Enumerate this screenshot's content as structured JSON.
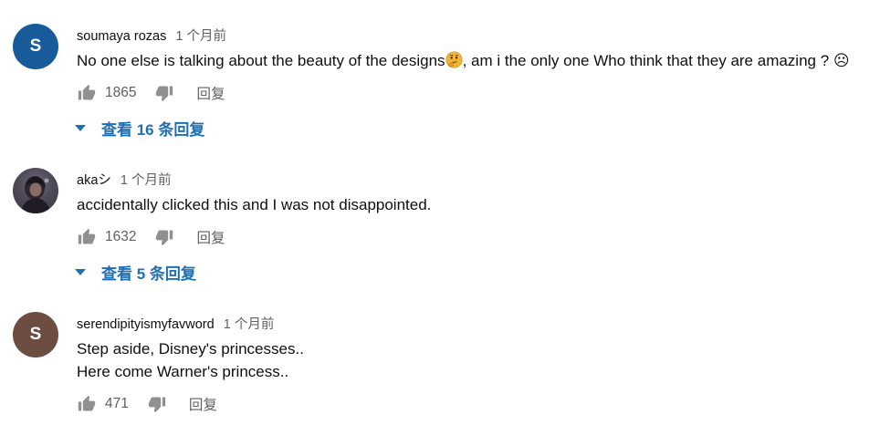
{
  "comments": [
    {
      "avatar_letter": "S",
      "avatar_color": "#175b9b",
      "author": "soumaya rozas",
      "time": "1 个月前",
      "text_before_emoji": "No one else is talking about the beauty of the designs",
      "emoji_icon": "thinking-face-icon",
      "text_after_emoji": ", am i the only one Who think that they are amazing ? ☹",
      "likes": "1865",
      "reply_label": "回复",
      "view_replies": "查看 16 条回复"
    },
    {
      "avatar_icon": "user-photo-avatar",
      "author": "akaシ",
      "time": "1 个月前",
      "text": "accidentally clicked this and I was not disappointed.",
      "likes": "1632",
      "reply_label": "回复",
      "view_replies": "查看 5 条回复"
    },
    {
      "avatar_letter": "S",
      "avatar_color": "#6d4c41",
      "author": "serendipityismyfavword",
      "time": "1 个月前",
      "text_line1": "Step aside, Disney's princesses..",
      "text_line2": "Here come Warner's princess..",
      "likes": "471",
      "reply_label": "回复"
    }
  ],
  "colors": {
    "link_blue": "#1f6fb5",
    "secondary_text": "#606060",
    "primary_text": "#0f0f0f"
  }
}
